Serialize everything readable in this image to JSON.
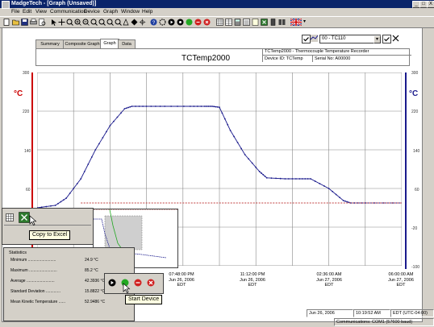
{
  "window": {
    "title": "MadgeTech - [Graph (Unsaved)]",
    "controls": [
      "_",
      "□",
      "X"
    ]
  },
  "menu": [
    "File",
    "Edit",
    "View",
    "Communication",
    "Device",
    "Graph",
    "Window",
    "Help"
  ],
  "device_selector": {
    "value": "00 - TC110"
  },
  "tabs": [
    "Summary",
    "Composite Graph",
    "Graph",
    "Data"
  ],
  "header": {
    "name": "TCTemp2000",
    "description": "TCTemp2000 - Thermocouple Temperature Recorder",
    "device_id": "Device ID: TCTemp",
    "serial": "Serial No: A00000"
  },
  "chart_data": {
    "type": "line",
    "ylabel_left": "°C",
    "ylabel_right": "°C",
    "ylim": [
      -100,
      300
    ],
    "yticks_left": [
      "300",
      "220",
      "140",
      "60"
    ],
    "yticks_right": [
      "300",
      "220",
      "140",
      "60",
      "-20",
      "-100"
    ],
    "x_labels": [
      "07:48:00 PM\nJun 26, 2006\nEDT",
      "11:12:00 PM\nJun 26, 2006\nEDT",
      "02:36:00 AM\nJun 27, 2006\nEDT",
      "06:00:00 AM\nJun 27, 2006\nEDT"
    ],
    "series": [
      {
        "color": "#1a1a8c",
        "x": [
          0,
          0.05,
          0.08,
          0.12,
          0.16,
          0.2,
          0.24,
          0.26,
          0.3,
          0.35,
          0.42,
          0.46,
          0.48,
          0.5,
          0.53,
          0.57,
          0.61,
          0.63,
          0.68,
          0.72,
          0.75,
          0.8,
          0.84,
          0.86,
          0.9,
          1.0
        ],
        "y": [
          20,
          25,
          40,
          80,
          140,
          190,
          225,
          230,
          230,
          230,
          230,
          230,
          230,
          228,
          180,
          130,
          95,
          82,
          80,
          80,
          80,
          60,
          35,
          30,
          30,
          30
        ]
      },
      {
        "color": "#c04040",
        "x": [
          0.12,
          1.0
        ],
        "y": [
          30,
          30
        ]
      }
    ]
  },
  "tools_popup": {
    "tooltip": "Copy to Excel"
  },
  "device_popup": {
    "tooltip": "Start Device"
  },
  "statistics": {
    "title": "Statistics",
    "rows": [
      {
        "label": "Minimum",
        "value": "24.9 °C"
      },
      {
        "label": "Maximum",
        "value": "85.2 °C"
      },
      {
        "label": "Average",
        "value": "42.3936 °C"
      },
      {
        "label": "Standard Deviation",
        "value": "15.8822 °C"
      },
      {
        "label": "Mean Kinetic Temperature",
        "value": "52.9486 °C"
      }
    ]
  },
  "status": {
    "date": "Jun 26, 2006",
    "time": "10:19:52 AM",
    "tz": "EDT (UTC-04:00)",
    "comms": "Communications: COM1 (57600 baud)"
  }
}
